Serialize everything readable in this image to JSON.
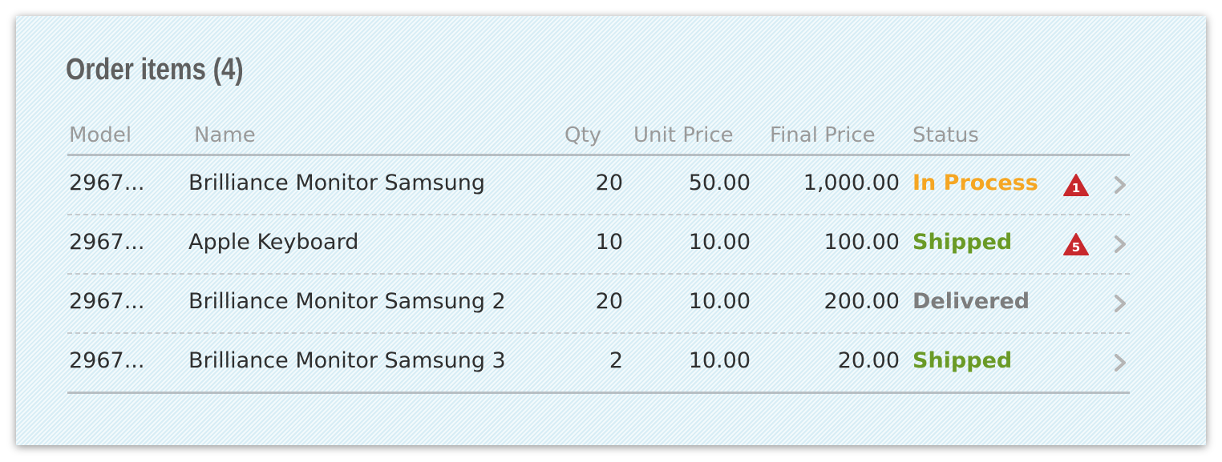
{
  "panel": {
    "title": "Order items (4)"
  },
  "table": {
    "columns": [
      "Model",
      "Name",
      "Qty",
      "Unit Price",
      "Final Price",
      "Status"
    ],
    "rows": [
      {
        "model": "2967...",
        "name": "Brilliance Monitor Samsung",
        "qty": "20",
        "unit_price": "50.00",
        "final_price": "1,000.00",
        "status": "In Process",
        "status_color": "#f5a623",
        "alert": "1"
      },
      {
        "model": "2967...",
        "name": "Apple Keyboard",
        "qty": "10",
        "unit_price": "10.00",
        "final_price": "100.00",
        "status": "Shipped",
        "status_color": "#6a9a26",
        "alert": "5"
      },
      {
        "model": "2967...",
        "name": "Brilliance Monitor Samsung 2",
        "qty": "20",
        "unit_price": "10.00",
        "final_price": "200.00",
        "status": "Delivered",
        "status_color": "#7d7d7d",
        "alert": null
      },
      {
        "model": "2967...",
        "name": "Brilliance Monitor Samsung 3",
        "qty": "2",
        "unit_price": "10.00",
        "final_price": "20.00",
        "status": "Shipped",
        "status_color": "#6a9a26",
        "alert": null
      }
    ]
  },
  "colors": {
    "alert": "#c8282d",
    "chevron": "#b5b5b5"
  },
  "icons": {
    "alert": "warning-triangle-icon",
    "row_action": "chevron-right-icon"
  }
}
